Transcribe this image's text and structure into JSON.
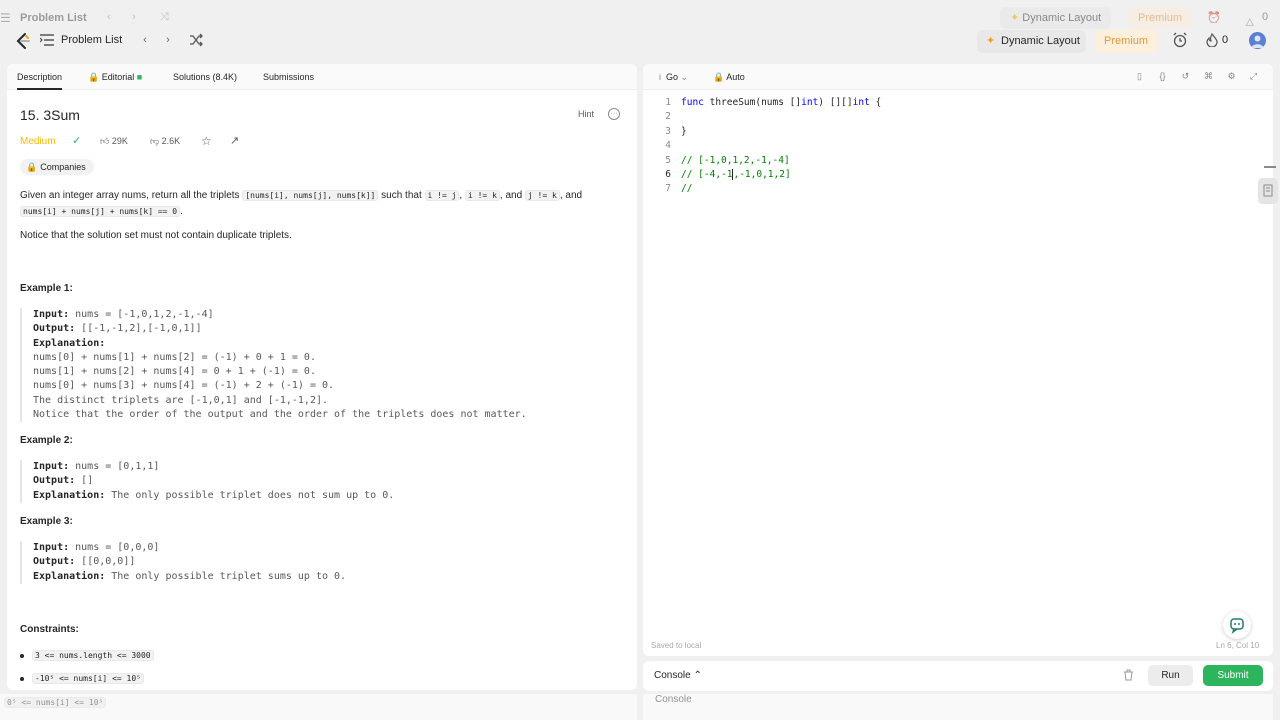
{
  "ghost": {
    "title": "Problem List",
    "dynamic": "Dynamic Layout",
    "premium": "Premium",
    "streak": "0"
  },
  "header": {
    "problem_list": "Problem List",
    "dynamic_layout": "Dynamic Layout",
    "premium": "Premium",
    "streak": "0"
  },
  "tabs": {
    "description": "Description",
    "editorial": "Editorial",
    "solutions": "Solutions (8.4K)",
    "submissions": "Submissions"
  },
  "problem": {
    "title": "15. 3Sum",
    "hint": "Hint",
    "difficulty": "Medium",
    "likes": "29K",
    "dislikes": "2.6K",
    "companies": "Companies",
    "desc_a": "Given an integer array nums, return all the triplets ",
    "desc_code1": "[nums[i], nums[j], nums[k]]",
    "desc_b": " such that ",
    "desc_code2": "i != j",
    "desc_c": ", ",
    "desc_code3": "i != k",
    "desc_d": ", and ",
    "desc_code4": "j != k",
    "desc_e": ", and",
    "desc_code5": "nums[i] + nums[j] + nums[k] == 0",
    "desc_f": ".",
    "notice": "Notice that the solution set must not contain duplicate triplets."
  },
  "examples": [
    {
      "title": "Example 1:",
      "input_label": "Input:",
      "input": " nums = [-1,0,1,2,-1,-4]",
      "output_label": "Output:",
      "output": " [[-1,-1,2],[-1,0,1]]",
      "explanation_label": "Explanation:",
      "lines": [
        "nums[0] + nums[1] + nums[2] = (-1) + 0 + 1 = 0.",
        "nums[1] + nums[2] + nums[4] = 0 + 1 + (-1) = 0.",
        "nums[0] + nums[3] + nums[4] = (-1) + 2 + (-1) = 0.",
        "The distinct triplets are [-1,0,1] and [-1,-1,2].",
        "Notice that the order of the output and the order of the triplets does not matter."
      ]
    },
    {
      "title": "Example 2:",
      "input_label": "Input:",
      "input": " nums = [0,1,1]",
      "output_label": "Output:",
      "output": " []",
      "explanation_label": "Explanation:",
      "explanation": " The only possible triplet does not sum up to 0."
    },
    {
      "title": "Example 3:",
      "input_label": "Input:",
      "input": " nums = [0,0,0]",
      "output_label": "Output:",
      "output": " [[0,0,0]]",
      "explanation_label": "Explanation:",
      "explanation": " The only possible triplet sums up to 0."
    }
  ],
  "constraints": {
    "title": "Constraints:",
    "items": [
      "3 <= nums.length <= 3000",
      "-10⁵ <= nums[i] <= 10⁵"
    ],
    "ghost_item": "0⁵ <= nums[i] <= 10⁵"
  },
  "editor": {
    "language": "Go",
    "mode": "Auto",
    "line_numbers": [
      "1",
      "2",
      "3",
      "4",
      "5",
      "6",
      "7"
    ],
    "code": {
      "l1_kw": "func",
      "l1_name": " threeSum(nums []",
      "l1_t1": "int",
      "l1_mid": ") [][]",
      "l1_t2": "int",
      "l1_end": " {",
      "l3": "}",
      "l5": "// [-1,0,1,2,-1,-4]",
      "l6_a": "// [-4,-1",
      "l6_b": ",-1,0,1,2]",
      "l7": "//"
    },
    "saved": "Saved to local",
    "position": "Ln 6, Col 10"
  },
  "console": {
    "label": "Console",
    "run": "Run",
    "submit": "Submit"
  }
}
